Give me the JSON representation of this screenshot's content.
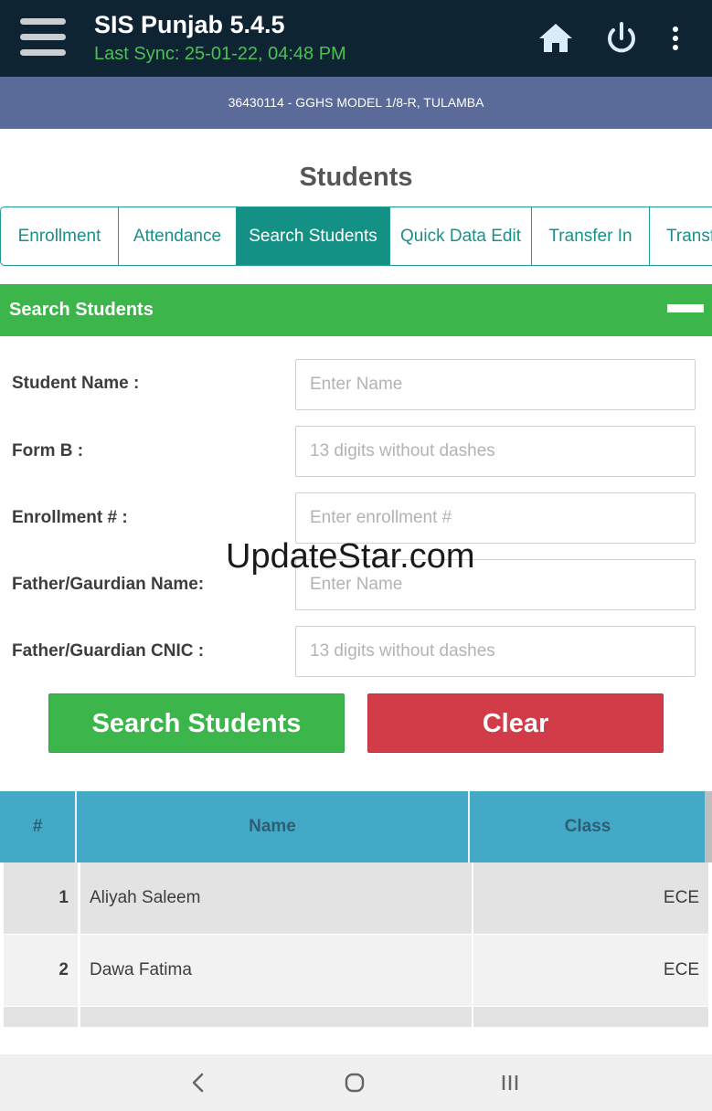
{
  "appbar": {
    "title": "SIS Punjab 5.4.5",
    "last_sync": "Last Sync: 25-01-22, 04:48 PM",
    "icons": [
      "menu-icon",
      "home-icon",
      "power-icon",
      "more-vert-icon"
    ]
  },
  "school": {
    "label": "36430114 - GGHS MODEL 1/8-R, TULAMBA"
  },
  "page": {
    "title": "Students"
  },
  "tabs": [
    {
      "label": "Enrollment",
      "active": false
    },
    {
      "label": "Attendance",
      "active": false
    },
    {
      "label": "Search Students",
      "active": true
    },
    {
      "label": "Quick Data Edit",
      "active": false
    },
    {
      "label": "Transfer In",
      "active": false
    },
    {
      "label": "Transf",
      "active": false
    }
  ],
  "section": {
    "title": "Search Students"
  },
  "form": {
    "fields": [
      {
        "label": "Student Name :",
        "value": "",
        "placeholder": "Enter Name"
      },
      {
        "label": "Form B :",
        "value": "",
        "placeholder": "13 digits without dashes"
      },
      {
        "label": "Enrollment # :",
        "value": "",
        "placeholder": "Enter enrollment #"
      },
      {
        "label": "Father/Gaurdian Name:",
        "value": "",
        "placeholder": "Enter Name"
      },
      {
        "label": "Father/Guardian CNIC :",
        "value": "",
        "placeholder": "13 digits without dashes"
      }
    ],
    "search_label": "Search Students",
    "clear_label": "Clear"
  },
  "watermark": "UpdateStar.com",
  "table": {
    "headers": [
      "#",
      "Name",
      "Class"
    ],
    "rows": [
      {
        "num": "1",
        "name": "Aliyah Saleem",
        "class": "ECE"
      },
      {
        "num": "2",
        "name": "Dawa Fatima",
        "class": "ECE"
      },
      {
        "num": "",
        "name": "",
        "class": ""
      }
    ]
  },
  "navbar": {
    "icons": [
      "back-icon",
      "home-circle-icon",
      "recents-icon"
    ]
  },
  "colors": {
    "appbar": "#0e2433",
    "sync_text": "#4cbf56",
    "banner": "#5a6a99",
    "tab_accent": "#149185",
    "section_green": "#3cb54a",
    "clear_red": "#d13c48",
    "table_header": "#44a9c7"
  }
}
